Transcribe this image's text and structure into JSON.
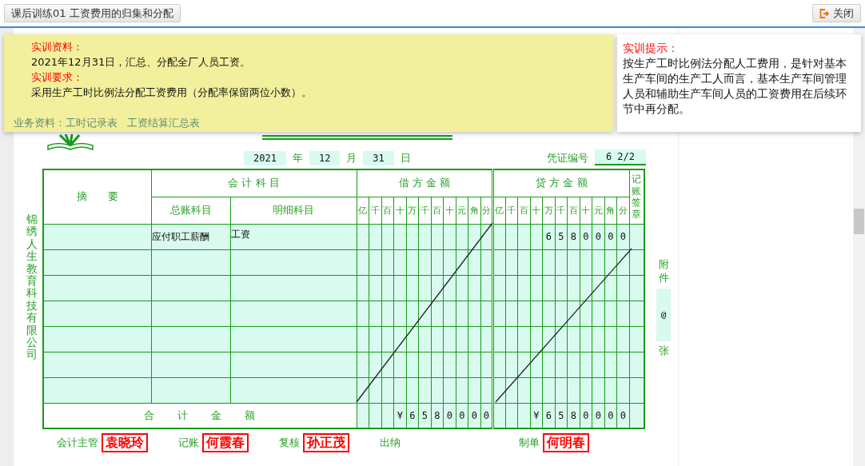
{
  "tab": {
    "label": "课后训练01 工资费用的归集和分配"
  },
  "close_button": {
    "label": "关闭"
  },
  "materials": {
    "heading": "实训资料：",
    "text": "2021年12月31日，汇总、分配全厂人员工资。",
    "requirement_heading": "实训要求：",
    "requirement_text": "采用生产工时比例法分配工资费用（分配率保留两位小数）。",
    "links_label": "业务资料：",
    "links": [
      "工时记录表",
      "工资结算汇总表"
    ]
  },
  "hint": {
    "heading": "实训提示：",
    "text": "按生产工时比例法分配人工费用，是针对基本生产车间的生产工人而言，基本生产车间管理人员和辅助生产车间人员的工资费用在后续环节中再分配。"
  },
  "voucher": {
    "year": "2021",
    "year_label": "年",
    "month": "12",
    "month_label": "月",
    "day": "31",
    "day_label": "日",
    "number_label": "凭证编号",
    "number": "6 2/2",
    "company": "锦绣人生教育科技有限公司",
    "headers": {
      "summary": "摘　　要",
      "accounts": "会 计 科 目",
      "general": "总账科目",
      "detail": "明细科目",
      "debit": "借 方 金 额",
      "credit": "贷 方 金 额",
      "sign": "记账签章"
    },
    "debit_units": [
      "亿",
      "千",
      "百",
      "十",
      "万",
      "千",
      "百",
      "十",
      "元",
      "角",
      "分"
    ],
    "credit_units": [
      "亿",
      "千",
      "百",
      "十",
      "万",
      "千",
      "百",
      "十",
      "元",
      "角",
      "分"
    ],
    "rows": [
      {
        "kind": "entry",
        "account": "应付职工薪酬",
        "detail": "工资",
        "credit": [
          "6",
          "5",
          "8",
          "0",
          "0",
          "0",
          "0"
        ]
      },
      {
        "kind": "blank"
      },
      {
        "kind": "blank"
      },
      {
        "kind": "blank"
      },
      {
        "kind": "blank"
      },
      {
        "kind": "blank"
      },
      {
        "kind": "blank"
      }
    ],
    "total_label": "合　　计　　金　　额",
    "total_debit": [
      "¥",
      "6",
      "5",
      "8",
      "0",
      "0",
      "0",
      "0"
    ],
    "total_credit": [
      "¥",
      "6",
      "5",
      "8",
      "0",
      "0",
      "0",
      "0"
    ],
    "attachments": {
      "label_top": "附件",
      "count": "@",
      "label_bottom": "张"
    },
    "signatures": [
      {
        "role": "会计主管",
        "name": "袁晓玲"
      },
      {
        "role": "记账",
        "name": "何霞春"
      },
      {
        "role": "复核",
        "name": "孙正茂"
      },
      {
        "role": "出纳"
      },
      {
        "role": "制单",
        "name": "何明春"
      }
    ]
  }
}
